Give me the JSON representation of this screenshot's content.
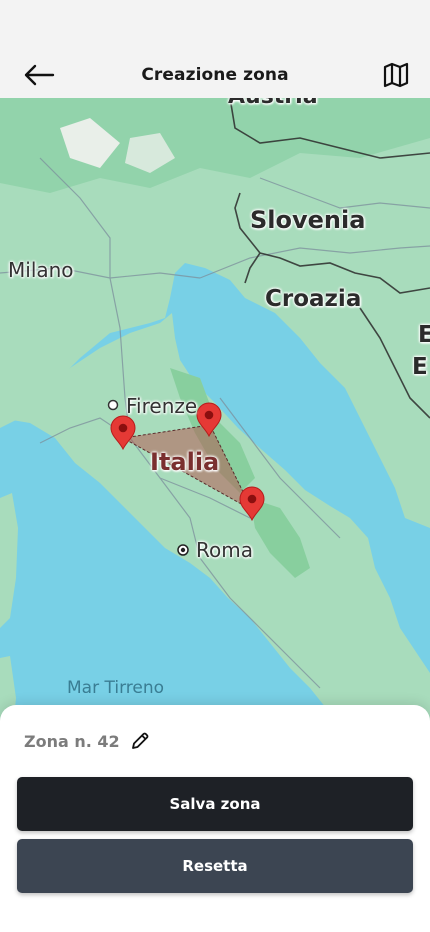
{
  "header": {
    "title": "Creazione zona",
    "back_icon": "arrow-left-icon",
    "map_icon": "map-icon"
  },
  "map": {
    "labels": {
      "austria": "Austria",
      "slovenia": "Slovenia",
      "milano": "Milano",
      "croazia": "Croazia",
      "e1": "E",
      "e2": "E",
      "firenze": "Firenze",
      "italia": "Italia",
      "roma": "Roma",
      "tirreno": "Mar Tirreno"
    },
    "marker_count": 3,
    "colors": {
      "sea": "#78d0e6",
      "land": "#a8dcbc",
      "marker": "#e53935",
      "zone_fill": "#b5504a"
    }
  },
  "sheet": {
    "zone_name": "Zona n. 42",
    "edit_icon": "pencil-icon",
    "save_label": "Salva zona",
    "reset_label": "Resetta"
  },
  "colors": {
    "save_button": "#1e2126",
    "reset_button": "#3c4552",
    "zone_name_text": "#7c7c7c"
  }
}
